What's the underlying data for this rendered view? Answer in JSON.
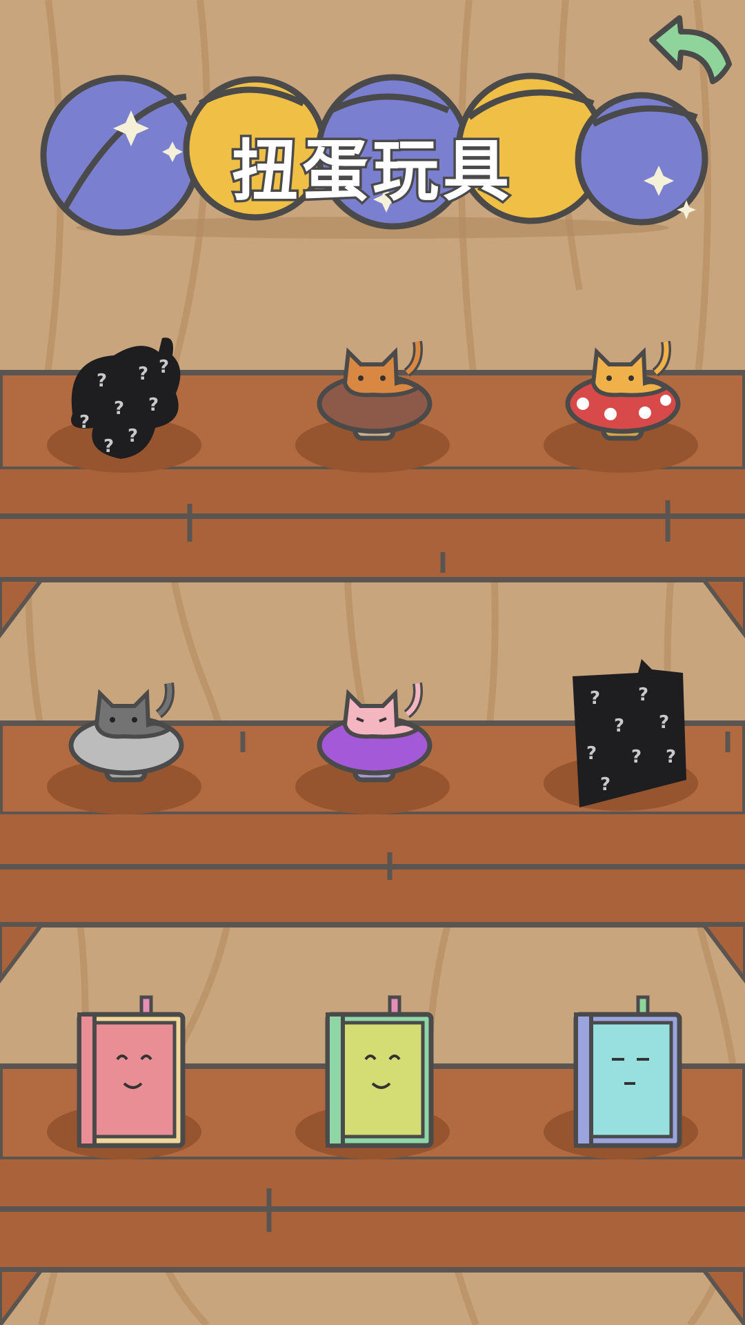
{
  "header": {
    "title": "扭蛋玩具",
    "back_icon": "back-arrow-icon"
  },
  "colors": {
    "wall": "#c9a57e",
    "shelf": "#b06a3f",
    "outline": "#5a5550",
    "capsule_blue": "#7b7fcf",
    "capsule_yellow": "#f0bf45",
    "back_arrow": "#8fd49b"
  },
  "shelves": [
    {
      "row": 1,
      "items": [
        {
          "name": "unknown cat on mushroom",
          "state": "locked",
          "icon": "question-mark-silhouette"
        },
        {
          "name": "orange cat on chocolate mushroom",
          "state": "unlocked",
          "icon": "cat-mushroom-icon"
        },
        {
          "name": "orange cat on red spotted mushroom",
          "state": "unlocked",
          "icon": "cat-mushroom-icon"
        }
      ]
    },
    {
      "row": 2,
      "items": [
        {
          "name": "grey cat on grey mushroom",
          "state": "unlocked",
          "icon": "cat-mushroom-icon"
        },
        {
          "name": "pink cat on purple mushroom",
          "state": "unlocked",
          "icon": "cat-mushroom-icon"
        },
        {
          "name": "unknown book",
          "state": "locked",
          "icon": "question-mark-silhouette"
        }
      ]
    },
    {
      "row": 3,
      "items": [
        {
          "name": "pink book",
          "state": "unlocked",
          "icon": "smiling-book-icon"
        },
        {
          "name": "green book",
          "state": "unlocked",
          "icon": "smiling-book-icon"
        },
        {
          "name": "blue book",
          "state": "unlocked",
          "icon": "sleepy-book-icon"
        }
      ]
    }
  ]
}
